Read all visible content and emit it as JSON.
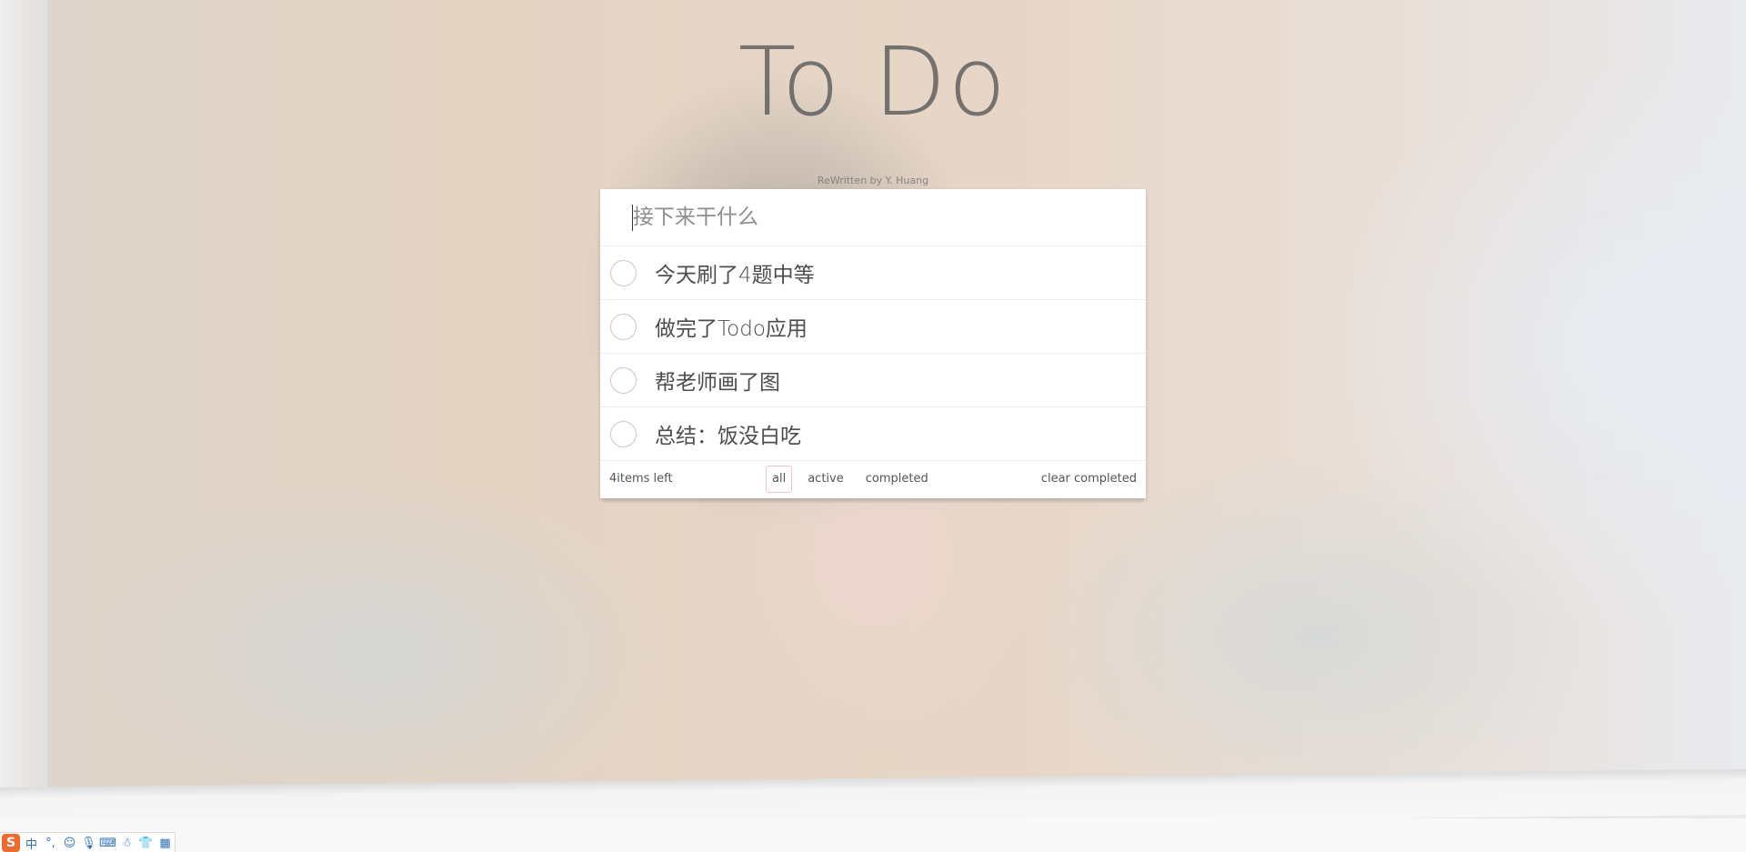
{
  "header": {
    "title": "To Do",
    "subtitle": "ReWritten by Y. Huang"
  },
  "new_todo": {
    "placeholder": "接下来干什么",
    "value": ""
  },
  "todos": [
    {
      "text": "今天刷了4题中等",
      "completed": false
    },
    {
      "text": "做完了Todo应用",
      "completed": false
    },
    {
      "text": "帮老师画了图",
      "completed": false
    },
    {
      "text": "总结：饭没白吃",
      "completed": false
    }
  ],
  "footer": {
    "count_label": "4items left",
    "filters": [
      {
        "label": "all",
        "selected": true
      },
      {
        "label": "active",
        "selected": false
      },
      {
        "label": "completed",
        "selected": false
      }
    ],
    "clear_label": "clear completed"
  },
  "ime_toolbar": {
    "logo": "S",
    "items": [
      {
        "glyph": "中",
        "icon": "chinese-mode-icon"
      },
      {
        "glyph": "°,",
        "icon": "punctuation-icon"
      },
      {
        "glyph": "☺",
        "icon": "emoji-icon"
      },
      {
        "glyph": "🎙",
        "icon": "microphone-icon"
      },
      {
        "glyph": "⌨",
        "icon": "keyboard-icon"
      },
      {
        "glyph": "☃",
        "icon": "user-icon"
      },
      {
        "glyph": "👕",
        "icon": "skin-icon"
      },
      {
        "glyph": "▦",
        "icon": "toolbox-icon"
      }
    ]
  },
  "colors": {
    "filter_selected_border": "#e7c7c7",
    "ime_logo": "#ef6a2e",
    "ime_icon": "#2f6fb8"
  }
}
